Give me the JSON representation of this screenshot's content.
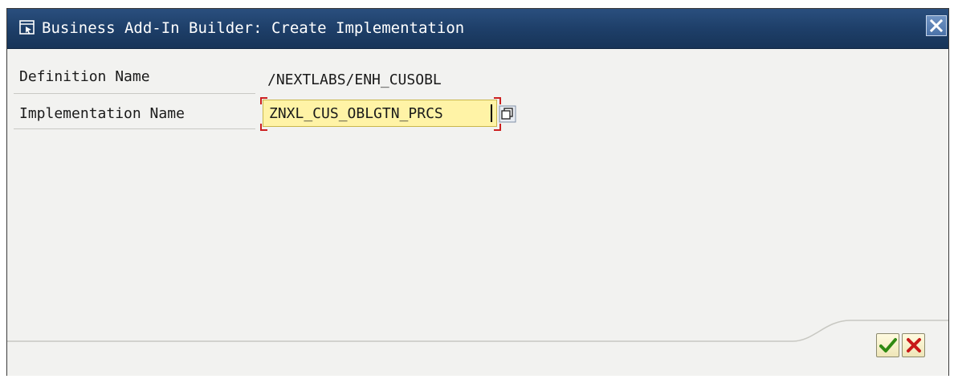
{
  "window": {
    "title": "Business Add-In Builder: Create Implementation",
    "title_icon": "dialog-icon",
    "close_icon": "close-icon"
  },
  "form": {
    "definition": {
      "label": "Definition Name",
      "value": "/NEXTLABS/ENH_CUSOBL"
    },
    "implementation": {
      "label": "Implementation Name",
      "value": "ZNXL_CUS_OBLGTN_PRCS",
      "help_icon": "value-help-icon"
    }
  },
  "actions": {
    "confirm_icon": "checkmark-icon",
    "cancel_icon": "cancel-x-icon"
  },
  "colors": {
    "titlebar": "#1e3f69",
    "input_background": "#fff3a6",
    "required_marker": "#cc2020",
    "confirm": "#3a9a1a",
    "cancel": "#c81818"
  }
}
